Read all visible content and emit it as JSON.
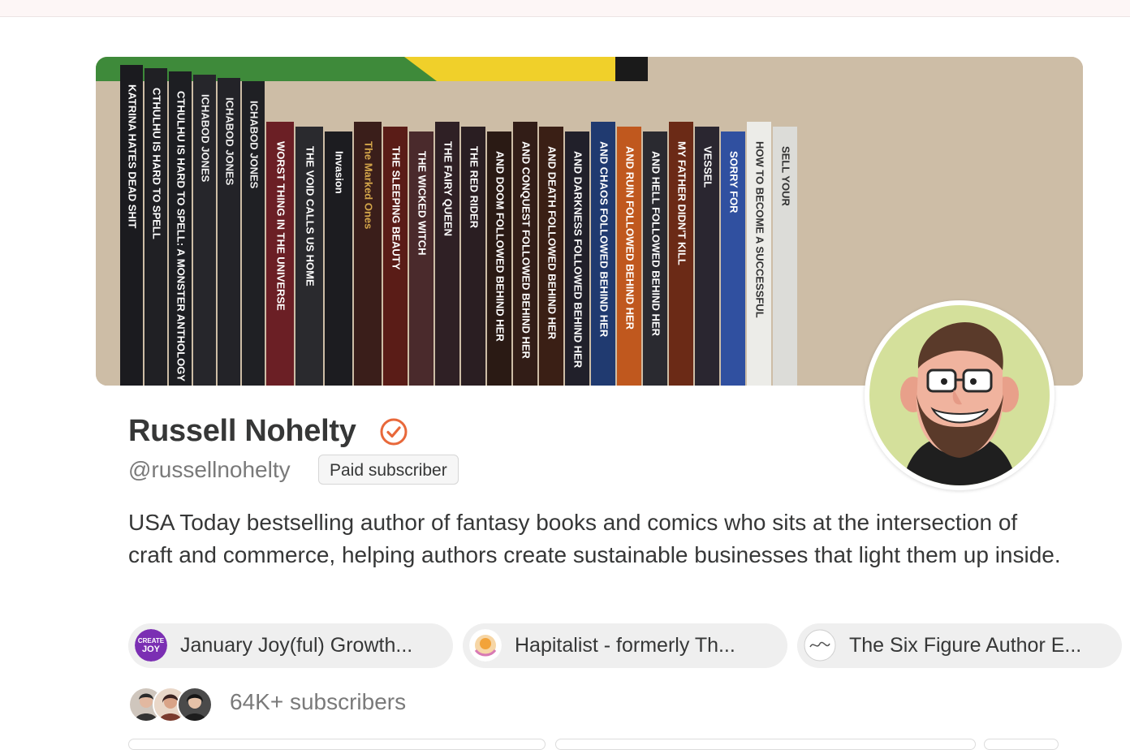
{
  "profile": {
    "name": "Russell Nohelty",
    "handle": "@russellnohelty",
    "badge": "Paid subscriber",
    "bio": "USA Today bestselling author of fantasy books and comics who sits at the intersection of craft and commerce, helping authors create sustainable businesses that light them up inside.",
    "subscribers": "64K+ subscribers",
    "verified_icon": "verified-check-icon",
    "accent_color": "#e8683a"
  },
  "publications": [
    {
      "label": "January Joy(ful) Growth...",
      "icon": "create-joy-logo"
    },
    {
      "label": "Hapitalist - formerly Th...",
      "icon": "hapitalist-logo"
    },
    {
      "label": "The Six Figure Author E...",
      "icon": "six-figure-author-logo"
    }
  ],
  "banner": {
    "spines": [
      "KATRINA HATES DEAD SHIT",
      "CTHULHU IS HARD TO SPELL",
      "CTHULHU IS HARD TO SPELL: A MONSTER ANTHOLOGY",
      "ICHABOD JONES",
      "ICHABOD JONES",
      "ICHABOD JONES",
      "WORST THING IN THE UNIVERSE",
      "THE VOID CALLS US HOME",
      "Invasion",
      "The Marked Ones",
      "THE SLEEPING BEAUTY",
      "THE WICKED WITCH",
      "THE FAIRY QUEEN",
      "THE RED RIDER",
      "AND DOOM FOLLOWED BEHIND HER",
      "AND CONQUEST FOLLOWED BEHIND HER",
      "AND DEATH FOLLOWED BEHIND HER",
      "AND DARKNESS FOLLOWED BEHIND HER",
      "AND CHAOS FOLLOWED BEHIND HER",
      "AND RUIN FOLLOWED BEHIND HER",
      "AND HELL FOLLOWED BEHIND HER",
      "MY FATHER DIDN'T KILL",
      "VESSEL",
      "SORRY FOR",
      "HOW TO BECOME A SUCCESSFUL",
      "SELL YOUR"
    ]
  }
}
